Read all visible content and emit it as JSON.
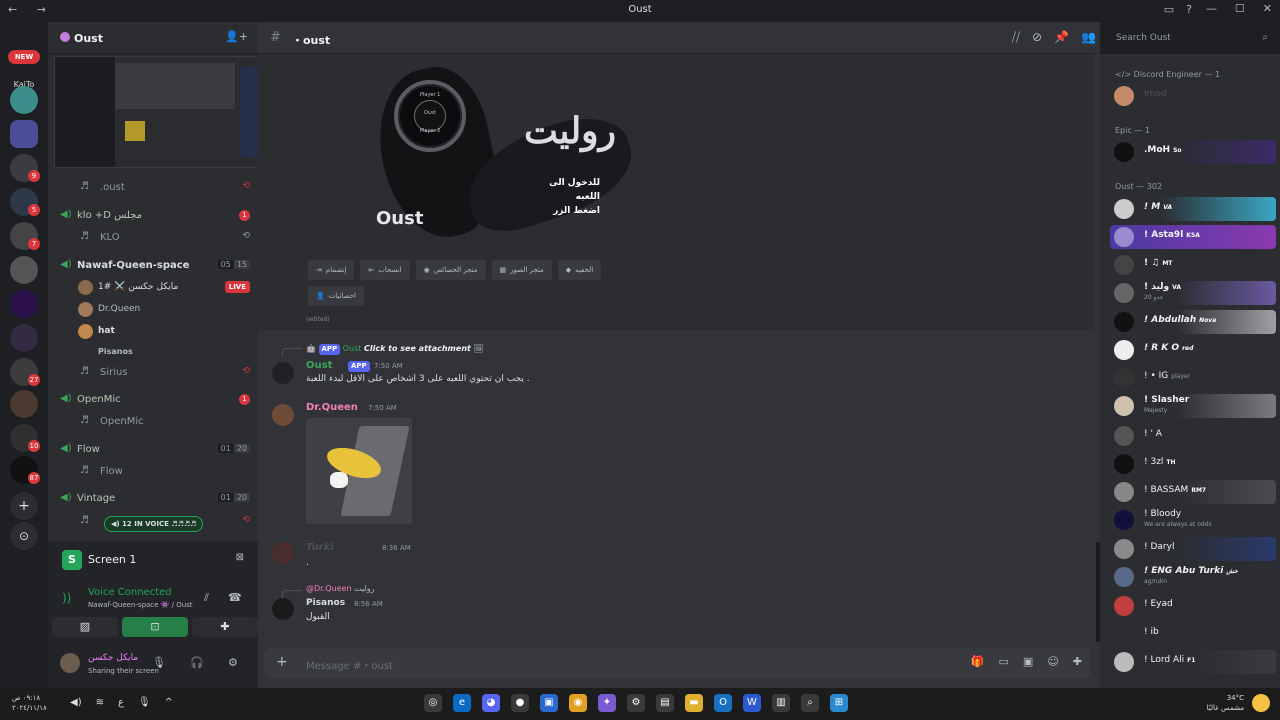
{
  "window": {
    "title": "Oust"
  },
  "rail": {
    "new_label": "NEW",
    "kaito_label": "KaiTo"
  },
  "guild": {
    "name": "Oust"
  },
  "channels": {
    "oust_text": ".oust",
    "klo_voice": "klo +D مجلس",
    "klo_sub": "KLO",
    "nawaf_voice": "Nawaf-Queen-space",
    "nawaf_counts": [
      "05",
      "15"
    ],
    "members_in_voice": [
      {
        "name": "مايكل جكسن ⚔️ #1",
        "live": "LIVE"
      },
      {
        "name": "Dr.Queen"
      },
      {
        "name": "hat"
      },
      {
        "name": "Pisanos"
      }
    ],
    "sirius": "Sirius",
    "openmic_voice": "OpenMic",
    "openmic_sub": "OpenMic",
    "flow_voice": "Flow",
    "flow_counts": [
      "01",
      "20"
    ],
    "flow_sub": "Flow",
    "vintage_voice": "Vintage",
    "vintage_counts": [
      "01",
      "20"
    ],
    "in_voice_label": "12 IN VOICE"
  },
  "screen_panel": {
    "title": "Screen 1",
    "voice_status": "Voice Connected",
    "voice_channel": "Nawaf-Queen-space 👾 / Oust"
  },
  "user": {
    "name": "مايكل جكسن",
    "status": "Sharing their screen"
  },
  "header": {
    "channel": "・oust"
  },
  "card": {
    "title_ar": "روليت",
    "subtitle_ar_line1": "للدخول الى اللعبه",
    "subtitle_ar_line2": "اضغط الزر",
    "ring_labels": [
      "Player 1",
      "Oust",
      "Player 2"
    ],
    "brand": "Oust",
    "buttons": [
      "إنضمام",
      "انسحاب",
      "متجر الخصائص",
      "متجر الصور",
      "الخقيه"
    ],
    "buttons_row2": [
      "احصائيات"
    ],
    "edited": "(edited)"
  },
  "messages": [
    {
      "reply_app": "APP",
      "reply_author": "Oust",
      "reply_text": "Click to see attachment",
      "author": "Oust",
      "tag": "APP",
      "time": "7:50 AM",
      "body": "يجب ان تحتوي اللعبه على 3 اشخاص على الاقل لبدء اللعبة ."
    },
    {
      "author": "Dr.Queen",
      "time": "7:50 AM"
    },
    {
      "author": "Turki",
      "time": "8:36 AM",
      "body": "."
    },
    {
      "reply_author": "@Dr.Queen",
      "reply_text": "روليت",
      "author": "Pisanos",
      "time": "8:56 AM",
      "body": "القبول"
    }
  ],
  "composer": {
    "placeholder": "Message #・oust"
  },
  "members": {
    "search_placeholder": "Search Oust",
    "groups": [
      {
        "label": "Discord Engineer — 1",
        "items": [
          {
            "name": "Imod"
          }
        ]
      },
      {
        "label": "Epic — 1",
        "items": [
          {
            "name": ".MoH",
            "tag": "So"
          }
        ]
      },
      {
        "label": "Oust — 302",
        "items": [
          {
            "name": "! M",
            "tag": "VA"
          },
          {
            "name": "! Asta9l",
            "tag": "KSA"
          },
          {
            "name": "! ♫",
            "tag": "MT"
          },
          {
            "name": "! وليد",
            "tag": "VA",
            "sub": "جدو 20"
          },
          {
            "name": "! Abdullah",
            "tag": "Nova"
          },
          {
            "name": "! R K O",
            "tag": "red"
          },
          {
            "name": "! • IG",
            "tag": "player"
          },
          {
            "name": "! Slasher",
            "sub": "Majesty"
          },
          {
            "name": "! ' A"
          },
          {
            "name": "! 3zl",
            "tag": "TH"
          },
          {
            "name": "! BASSAM",
            "tag": "RM7"
          },
          {
            "name": "! Bloody",
            "sub": "We are always at odds"
          },
          {
            "name": "! Daryl"
          },
          {
            "name": "! ENG Abu Turki",
            "tag": "خش",
            "sub": "ag/rukn"
          },
          {
            "name": "! Eyad"
          },
          {
            "name": "! ib"
          },
          {
            "name": "! Lord Ali",
            "tag": "F1"
          }
        ]
      }
    ]
  },
  "taskbar": {
    "time": "٠٩:١٨ ص",
    "date": "٢٠٢٤/١١/١٨",
    "lang": "ع",
    "temp": "34°C",
    "weather": "مشمس غالبًا"
  },
  "colors": {
    "accent": "#5865f2",
    "green": "#23a55a",
    "red": "#da373c",
    "drqueen": "#f47fb4",
    "oust": "#3ba55c"
  }
}
